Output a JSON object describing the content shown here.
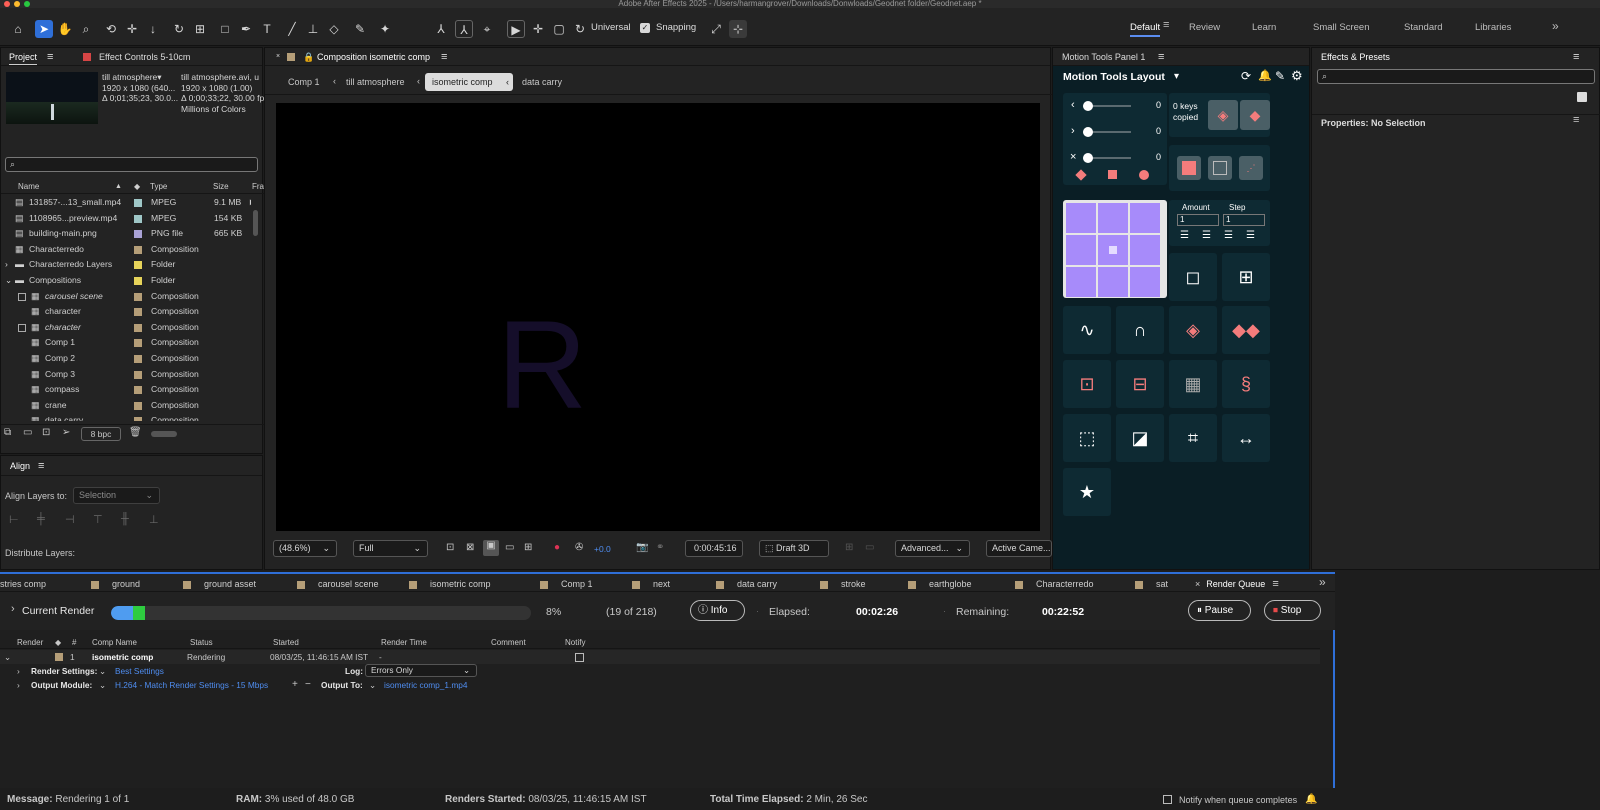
{
  "app": {
    "title": "Adobe After Effects 2025 - /Users/harmangrover/Downloads/Donwloads/Geodnet folder/Geodnet.aep *"
  },
  "toolbar": {
    "universal_label": "Universal",
    "snapping_label": "Snapping",
    "workspaces": [
      "Default",
      "Review",
      "Learn",
      "Small Screen",
      "Standard",
      "Libraries"
    ]
  },
  "project": {
    "tab_project": "Project",
    "tab_effect_controls": "Effect Controls 5-10cm",
    "preview_name": "till atmosphere",
    "preview_res": "1920 x 1080  (640...",
    "preview_dur": "Δ 0;01;35;23, 30.0...",
    "preview_file": "till atmosphere.avi, u",
    "preview_file_res": "1920 x 1080 (1.00)",
    "preview_file_dur": "Δ 0;00;33;22, 30.00 fps",
    "preview_colors": "Millions of Colors",
    "columns": {
      "name": "Name",
      "type": "Type",
      "size": "Size",
      "fr": "Fra"
    },
    "items": [
      {
        "name": "131857-...13_small.mp4",
        "type": "MPEG",
        "size": "9.1 MB",
        "color": "#9fc7c7",
        "icon": "video-file-icon"
      },
      {
        "name": "1108965...preview.mp4",
        "type": "MPEG",
        "size": "154 KB",
        "color": "#9fc7c7",
        "icon": "video-file-icon"
      },
      {
        "name": "building-main.png",
        "type": "PNG file",
        "size": "665 KB",
        "color": "#a9a2d6",
        "icon": "image-file-icon"
      },
      {
        "name": "Characterredo",
        "type": "Composition",
        "size": "",
        "color": "#b59e78",
        "icon": "composition-icon"
      },
      {
        "name": "Characterredo Layers",
        "type": "Folder",
        "size": "",
        "color": "#e6d35a",
        "icon": "folder-icon"
      },
      {
        "name": "Compositions",
        "type": "Folder",
        "size": "",
        "color": "#e6d35a",
        "icon": "folder-icon"
      },
      {
        "name": "carousel scene",
        "type": "Composition",
        "size": "",
        "color": "#b59e78",
        "icon": "composition-icon"
      },
      {
        "name": "character",
        "type": "Composition",
        "size": "",
        "color": "#b59e78",
        "icon": "composition-icon"
      },
      {
        "name": "character",
        "type": "Composition",
        "size": "",
        "color": "#b59e78",
        "icon": "composition-icon"
      },
      {
        "name": "Comp 1",
        "type": "Composition",
        "size": "",
        "color": "#b59e78",
        "icon": "composition-icon"
      },
      {
        "name": "Comp 2",
        "type": "Composition",
        "size": "",
        "color": "#b59e78",
        "icon": "composition-icon"
      },
      {
        "name": "Comp 3",
        "type": "Composition",
        "size": "",
        "color": "#b59e78",
        "icon": "composition-icon"
      },
      {
        "name": "compass",
        "type": "Composition",
        "size": "",
        "color": "#b59e78",
        "icon": "composition-icon"
      },
      {
        "name": "crane",
        "type": "Composition",
        "size": "",
        "color": "#b59e78",
        "icon": "composition-icon"
      },
      {
        "name": "data carry",
        "type": "Composition",
        "size": "",
        "color": "#b59e78",
        "icon": "composition-icon"
      }
    ],
    "bpc": "8 bpc"
  },
  "align": {
    "title": "Align",
    "align_to_label": "Align Layers to:",
    "align_to_value": "Selection",
    "distribute_label": "Distribute Layers:"
  },
  "composition": {
    "title": "Composition isometric comp",
    "breadcrumbs": [
      "Comp 1",
      "till atmosphere",
      "isometric comp",
      "data carry"
    ],
    "viewer_letter": "R",
    "zoom": "(48.6%)",
    "resolution": "Full",
    "exposure": "+0.0",
    "timecode": "0:00:45:16",
    "draft3d": "Draft 3D",
    "renderer": "Advanced...",
    "camera": "Active Came..."
  },
  "motion_tools": {
    "panel_title": "Motion Tools Panel 1",
    "layout_label": "Motion Tools Layout",
    "slider_values": [
      "0",
      "0",
      "0"
    ],
    "keys_copied": "0 keys copied",
    "amount_label": "Amount",
    "step_label": "Step",
    "amount_value": "1",
    "step_value": "1"
  },
  "effects": {
    "title": "Effects & Presets",
    "properties_label": "Properties: No Selection"
  },
  "timeline_tabs": [
    "stries comp",
    "ground",
    "ground asset",
    "carousel scene",
    "isometric comp",
    "Comp 1",
    "next",
    "data carry",
    "stroke",
    "earthglobe",
    "Characterredo",
    "sat",
    "Render Queue"
  ],
  "render_queue": {
    "current_render_label": "Current Render",
    "progress_percent": 8,
    "progress_text": "8%",
    "frames_text": "(19 of 218)",
    "info_label": "Info",
    "elapsed_label": "Elapsed:",
    "elapsed_value": "00:02:26",
    "remaining_label": "Remaining:",
    "remaining_value": "00:22:52",
    "pause_label": "Pause",
    "stop_label": "Stop",
    "columns": [
      "Render",
      "#",
      "Comp Name",
      "Status",
      "Started",
      "Render Time",
      "Comment",
      "Notify"
    ],
    "item": {
      "index": "1",
      "comp_name": "isometric comp",
      "status": "Rendering",
      "started": "08/03/25, 11:46:15 AM IST",
      "render_time": "-"
    },
    "render_settings_label": "Render Settings:",
    "render_settings_value": "Best Settings",
    "log_label": "Log:",
    "log_value": "Errors Only",
    "output_module_label": "Output Module:",
    "output_module_value": "H.264 - Match Render Settings - 15 Mbps",
    "output_to_label": "Output To:",
    "output_to_value": "isometric comp_1.mp4"
  },
  "status_bar": {
    "message_label": "Message:",
    "message_value": "Rendering 1 of 1",
    "ram_label": "RAM:",
    "ram_value": "3% used of 48.0 GB",
    "renders_started_label": "Renders Started:",
    "renders_started_value": "08/03/25, 11:46:15 AM IST",
    "total_time_label": "Total Time Elapsed:",
    "total_time_value": "2 Min, 26 Sec",
    "notify_label": "Notify when queue completes"
  },
  "colors": {
    "accent_blue": "#2f6fd8",
    "progress_blue": "#4f9cf0",
    "progress_green": "#2ecc40",
    "motion_purple": "#a78bfa",
    "motion_coral": "#f47c7c",
    "motion_bg": "#0a1e25",
    "stop_red": "#e84a4a"
  }
}
